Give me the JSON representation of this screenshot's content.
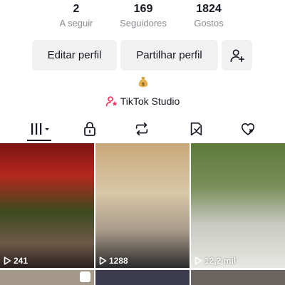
{
  "profile": {
    "stats": [
      {
        "value": "2",
        "label": "A seguir"
      },
      {
        "value": "169",
        "label": "Seguidores"
      },
      {
        "value": "1824",
        "label": "Gostos"
      }
    ],
    "buttons": {
      "edit_label": "Editar perfil",
      "share_label": "Partilhar perfil",
      "add_friend_icon": "add-user-icon"
    },
    "bio_emoji": "money-bag-icon",
    "studio_link": "TikTok Studio"
  },
  "tabs": [
    {
      "icon": "grid-icon",
      "selected": true
    },
    {
      "icon": "lock-icon",
      "selected": false
    },
    {
      "icon": "repost-icon",
      "selected": false
    },
    {
      "icon": "favorites-icon",
      "selected": false
    },
    {
      "icon": "liked-icon",
      "selected": false
    }
  ],
  "videos": [
    {
      "views": "241"
    },
    {
      "views": "1288"
    },
    {
      "views": "12,2 mil"
    }
  ],
  "colors": {
    "text": "#161823",
    "secondary_text": "#8a8b91",
    "button_bg": "#f1f1f2",
    "studio_icon": "#fe2c55"
  }
}
